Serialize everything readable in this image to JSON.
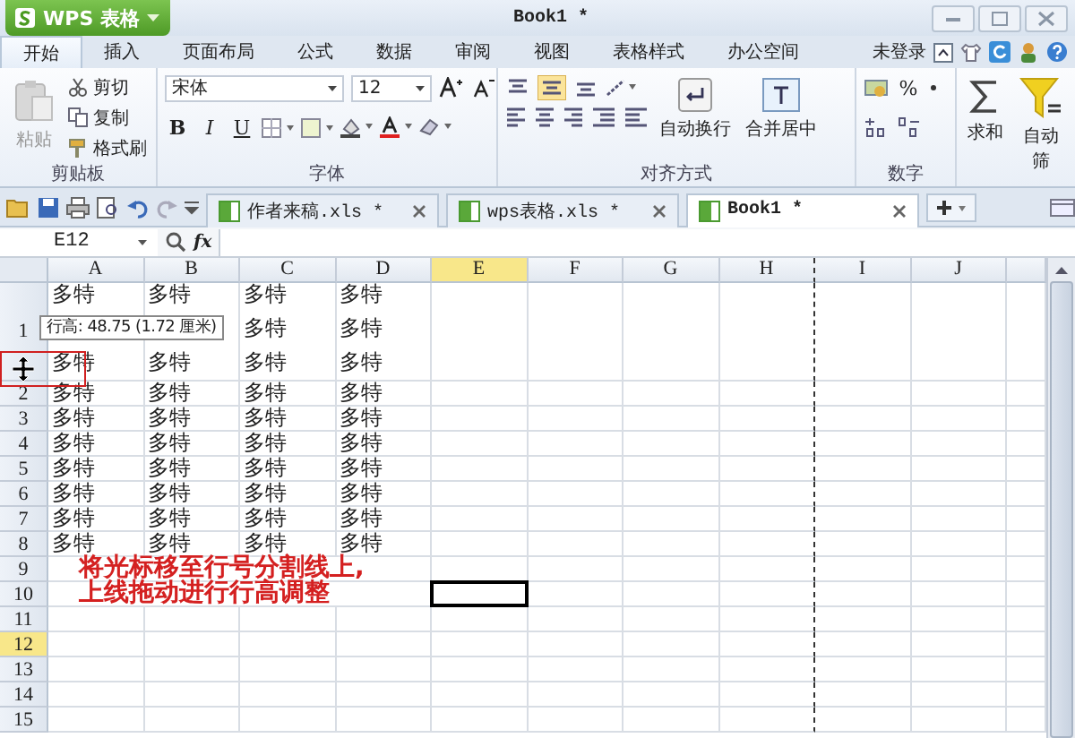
{
  "app_button": {
    "label": "WPS 表格"
  },
  "window": {
    "title": "Book1 *"
  },
  "ribbon_tabs": [
    {
      "label": "开始",
      "selected": true
    },
    {
      "label": "插入",
      "selected": false
    },
    {
      "label": "页面布局",
      "selected": false
    },
    {
      "label": "公式",
      "selected": false
    },
    {
      "label": "数据",
      "selected": false
    },
    {
      "label": "审阅",
      "selected": false
    },
    {
      "label": "视图",
      "selected": false
    },
    {
      "label": "表格样式",
      "selected": false
    },
    {
      "label": "办公空间",
      "selected": false
    }
  ],
  "login": "未登录",
  "ribbon": {
    "clipboard": {
      "paste": "粘贴",
      "cut": "剪切",
      "copy": "复制",
      "format_painter": "格式刷",
      "group": "剪贴板"
    },
    "font": {
      "name": "宋体",
      "size": "12",
      "bold": "B",
      "italic": "I",
      "underline": "U",
      "group": "字体"
    },
    "alignment": {
      "wrap": "自动换行",
      "merge": "合并居中",
      "group": "对齐方式"
    },
    "number": {
      "percent": "%",
      "group": "数字"
    },
    "sum": "求和",
    "filter": "自动筛"
  },
  "doc_tabs": [
    {
      "name": "作者来稿.xls *",
      "selected": false
    },
    {
      "name": "wps表格.xls *",
      "selected": false
    },
    {
      "name": "Book1 *",
      "selected": true
    }
  ],
  "name_box": "E12",
  "function_label": "fx",
  "columns": [
    {
      "label": "A",
      "selected": false,
      "page_break_after": false
    },
    {
      "label": "B",
      "selected": false,
      "page_break_after": false
    },
    {
      "label": "C",
      "selected": false,
      "page_break_after": false
    },
    {
      "label": "D",
      "selected": false,
      "page_break_after": false
    },
    {
      "label": "E",
      "selected": true,
      "page_break_after": false
    },
    {
      "label": "F",
      "selected": false,
      "page_break_after": false
    },
    {
      "label": "G",
      "selected": false,
      "page_break_after": false
    },
    {
      "label": "H",
      "selected": false,
      "page_break_after": true
    },
    {
      "label": "I",
      "selected": false,
      "page_break_after": false
    },
    {
      "label": "J",
      "selected": false,
      "page_break_after": false
    }
  ],
  "rows": [
    {
      "number": "1",
      "selected": false,
      "cursor_box": false,
      "cells": [
        [
          "多特",
          "多特"
        ],
        [
          "多特",
          "多特"
        ],
        [
          "多特",
          "多特",
          "多特"
        ],
        [
          "多特",
          "多特",
          "多特"
        ]
      ]
    },
    {
      "number": "2",
      "selected": false,
      "cursor_box": false,
      "cells": [
        [
          "多特"
        ],
        [
          "多特"
        ],
        [
          "多特"
        ],
        [
          "多特"
        ]
      ]
    },
    {
      "number": "3",
      "selected": false,
      "cursor_box": false,
      "cells": [
        [
          "多特"
        ],
        [
          "多特"
        ],
        [
          "多特"
        ],
        [
          "多特"
        ]
      ]
    },
    {
      "number": "4",
      "selected": false,
      "cursor_box": false,
      "cells": [
        [
          "多特"
        ],
        [
          "多特"
        ],
        [
          "多特"
        ],
        [
          "多特"
        ]
      ]
    },
    {
      "number": "5",
      "selected": false,
      "cursor_box": false,
      "cells": [
        [
          "多特"
        ],
        [
          "多特"
        ],
        [
          "多特"
        ],
        [
          "多特"
        ]
      ]
    },
    {
      "number": "6",
      "selected": false,
      "cursor_box": false,
      "cells": [
        [
          "多特"
        ],
        [
          "多特"
        ],
        [
          "多特"
        ],
        [
          "多特"
        ]
      ]
    },
    {
      "number": "7",
      "selected": false,
      "cursor_box": false,
      "cells": [
        [
          "多特"
        ],
        [
          "多特"
        ],
        [
          "多特"
        ],
        [
          "多特"
        ]
      ]
    },
    {
      "number": "8",
      "selected": false,
      "cursor_box": false,
      "cells": [
        [
          "多特"
        ],
        [
          "多特"
        ],
        [
          "多特"
        ],
        [
          "多特"
        ]
      ]
    },
    {
      "number": "9",
      "selected": false,
      "cursor_box": false,
      "cells": [],
      "note": "将光标移至行号分割线上,"
    },
    {
      "number": "10",
      "selected": false,
      "cursor_box": true,
      "cells": [],
      "note": "上线拖动进行行高调整"
    },
    {
      "number": "11",
      "selected": false,
      "cursor_box": false,
      "cells": []
    },
    {
      "number": "12",
      "selected": true,
      "cursor_box": false,
      "cells": []
    },
    {
      "number": "13",
      "selected": false,
      "cursor_box": false,
      "cells": []
    },
    {
      "number": "14",
      "selected": false,
      "cursor_box": false,
      "cells": []
    },
    {
      "number": "15",
      "selected": false,
      "cursor_box": false,
      "cells": []
    }
  ],
  "tooltip": "行高: 48.75 (1.72 厘米)"
}
